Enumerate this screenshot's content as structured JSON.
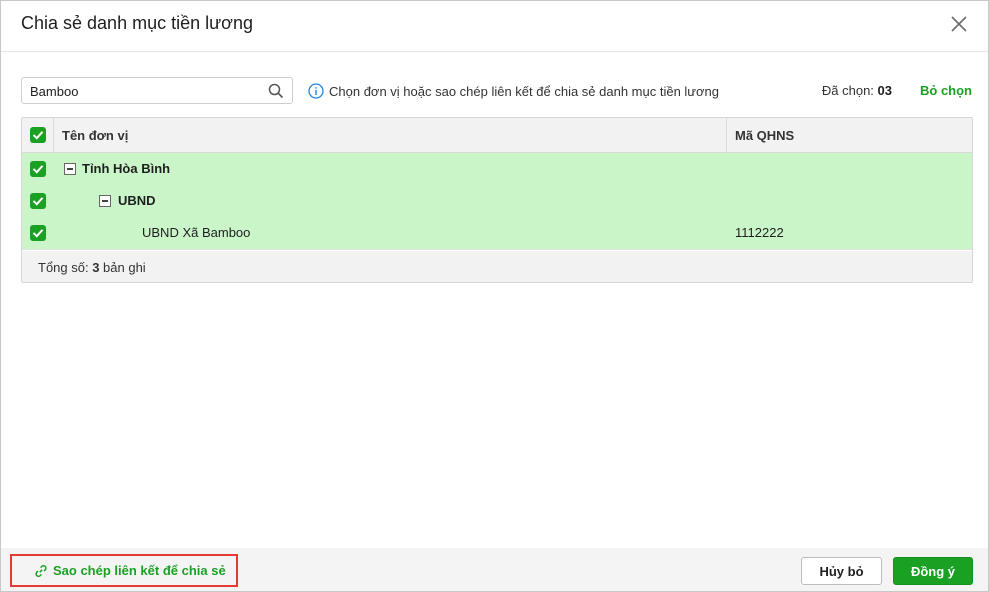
{
  "dialog": {
    "title": "Chia sẻ danh mục tiền lương"
  },
  "search": {
    "value": "Bamboo",
    "icon": "search-icon"
  },
  "info": {
    "text": "Chọn đơn vị hoặc sao chép liên kết để chia sẻ danh mục tiền lương"
  },
  "selection": {
    "label": "Đã chọn: ",
    "count": "03",
    "deselect_label": "Bỏ chọn"
  },
  "grid": {
    "columns": [
      "Tên đơn vị",
      "Mã QHNS"
    ],
    "rows": [
      {
        "name": "Tỉnh Hòa Bình",
        "code": "",
        "checked": true,
        "level": 0,
        "expanded": true
      },
      {
        "name": "UBND",
        "code": "",
        "checked": true,
        "level": 1,
        "expanded": true
      },
      {
        "name": "UBND Xã Bamboo",
        "code": "1112222",
        "checked": true,
        "level": 2
      }
    ],
    "footer": {
      "prefix": "Tổng số: ",
      "count": "3",
      "suffix": " bản ghi"
    }
  },
  "footer": {
    "copy_link_label": "Sao chép liên kết để chia sẻ",
    "cancel_label": "Hủy bỏ",
    "ok_label": "Đồng ý"
  },
  "colors": {
    "accent": "#1aa124",
    "selected_row": "#c9f5c9",
    "highlight_border": "#e53935"
  }
}
